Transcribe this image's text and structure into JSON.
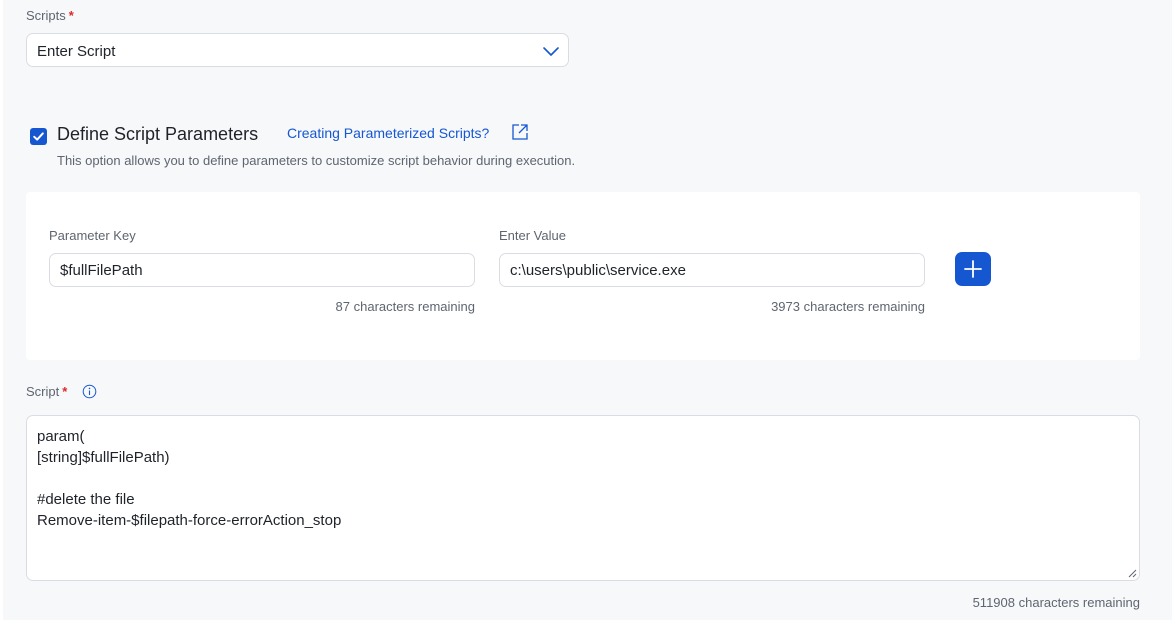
{
  "scripts_field": {
    "label": "Scripts",
    "required_mark": "*",
    "selected_value": "Enter Script"
  },
  "parameters": {
    "checkbox_label": "Define Script Parameters",
    "checked": true,
    "help_link": "Creating Parameterized Scripts?",
    "description": "This option allows you to define parameters to customize script behavior during execution.",
    "key_label": "Parameter Key",
    "key_value": "$fullFilePath",
    "key_remaining": "87 characters remaining",
    "value_label": "Enter Value",
    "value_value": "c:\\users\\public\\service.exe",
    "value_remaining": "3973 characters remaining"
  },
  "script_field": {
    "label": "Script",
    "required_mark": "*",
    "content": "param(\n[string]$fullFilePath)\n\n#delete the file\nRemove-item-$filepath-force-errorAction_stop",
    "remaining": "511908 characters remaining"
  },
  "icons": {
    "dropdown": "chevron-down-icon",
    "checkbox": "check-icon",
    "help_link": "external-link-icon",
    "add": "plus-icon",
    "script_info": "info-icon",
    "resize": "resize-handle-icon"
  },
  "colors": {
    "accent": "#1557d1",
    "required": "#e0262a",
    "panel_background": "#f7f8fa",
    "border": "#d9dde3"
  }
}
